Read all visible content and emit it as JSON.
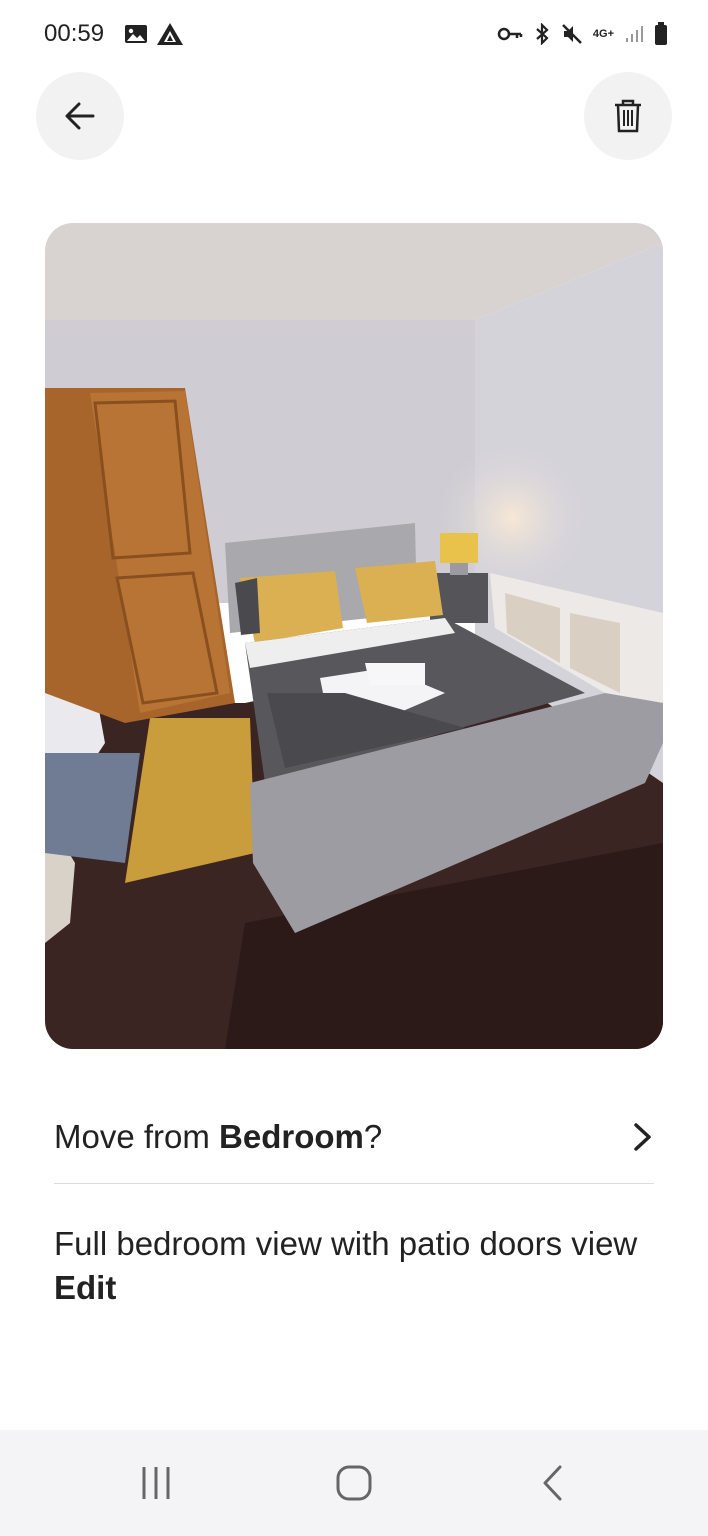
{
  "status": {
    "time": "00:59",
    "network": "4G+",
    "icons_left": [
      "image-icon",
      "app-icon"
    ],
    "icons_right": [
      "key-icon",
      "bluetooth-icon",
      "mute-icon",
      "network-icon",
      "signal-icon",
      "battery-icon"
    ]
  },
  "header": {
    "back_icon": "arrow-left-icon",
    "delete_icon": "trash-icon"
  },
  "photo": {
    "description_icon": "bedroom-photo"
  },
  "move": {
    "prefix": "Move from ",
    "room": "Bedroom",
    "suffix": "?"
  },
  "caption": {
    "text": "Full bedroom view with patio doors view ",
    "edit_label": "Edit"
  },
  "navbar": {
    "recents_icon": "recents-icon",
    "home_icon": "home-icon",
    "back_icon": "back-icon"
  },
  "colors": {
    "text": "#222222",
    "button_bg": "#f2f2f2",
    "divider": "#dddddd",
    "navbar_bg": "#f4f4f6"
  }
}
